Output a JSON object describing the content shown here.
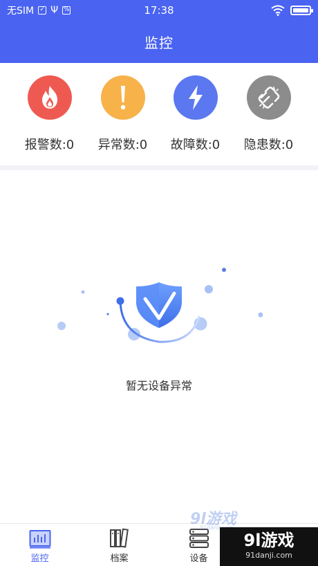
{
  "status_bar": {
    "carrier": "无SIM",
    "time": "17:38"
  },
  "header": {
    "title": "监控"
  },
  "stats": [
    {
      "label": "报警数:0",
      "icon": "fire-icon",
      "color": "#ee5a52"
    },
    {
      "label": "异常数:0",
      "icon": "exclamation-icon",
      "color": "#f7b24a"
    },
    {
      "label": "故障数:0",
      "icon": "lightning-icon",
      "color": "#5b78f0"
    },
    {
      "label": "隐患数:0",
      "icon": "broken-link-icon",
      "color": "#8c8c8c"
    }
  ],
  "empty_state": {
    "message": "暂无设备异常",
    "icon": "shield-check-icon"
  },
  "tabbar": {
    "tabs": [
      {
        "label": "监控",
        "icon": "monitor-chart-icon",
        "active": true
      },
      {
        "label": "档案",
        "icon": "archive-books-icon",
        "active": false
      },
      {
        "label": "设备",
        "icon": "server-stack-icon",
        "active": false
      }
    ]
  },
  "watermark": {
    "main": "9l游戏",
    "sub": "91danji.com",
    "ghost_main": "9l游戏",
    "ghost_sub": "91danji.com"
  },
  "colors": {
    "primary": "#4a63f0",
    "divider": "#f2f3f7"
  }
}
